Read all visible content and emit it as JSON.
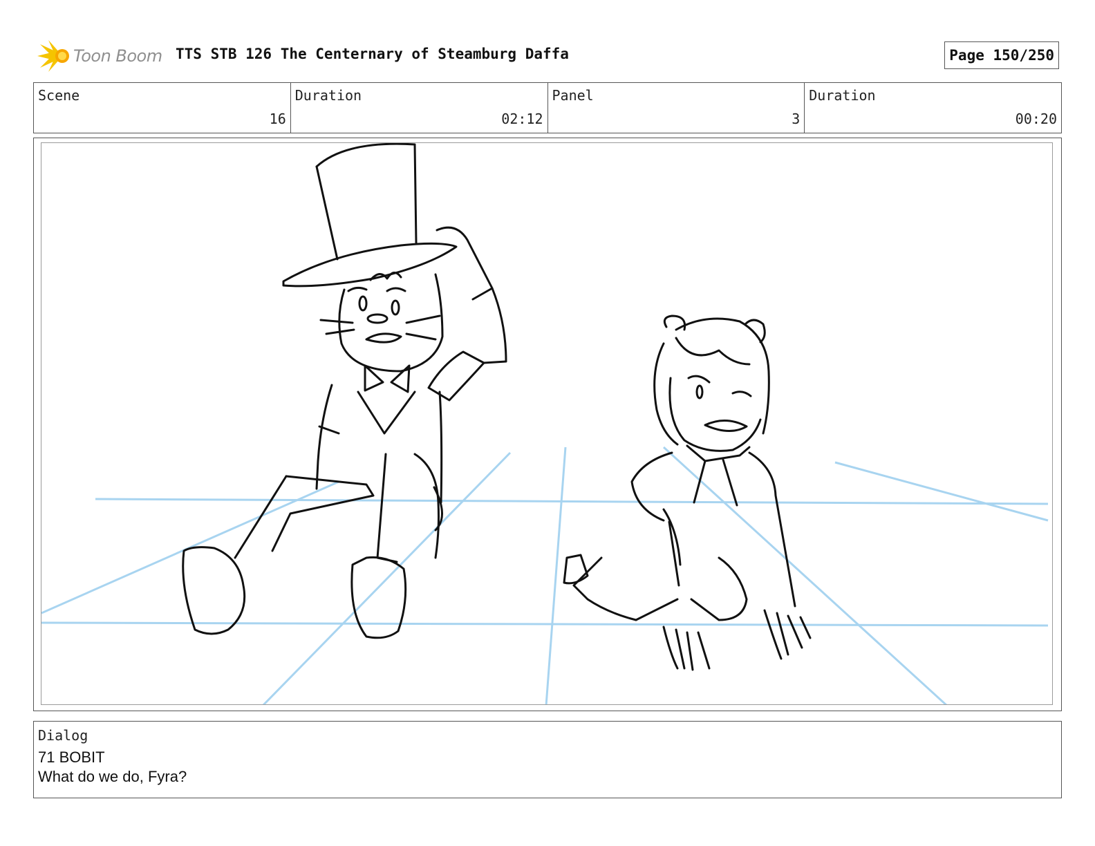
{
  "header": {
    "logo_text": "Toon Boom",
    "title": "TTS STB 126 The Centernary of Steamburg Daffa",
    "page": "Page 150/250"
  },
  "info": {
    "scene_label": "Scene",
    "scene_value": "16",
    "scene_duration_label": "Duration",
    "scene_duration_value": "02:12",
    "panel_label": "Panel",
    "panel_value": "3",
    "panel_duration_label": "Duration",
    "panel_duration_value": "00:20"
  },
  "dialog": {
    "label": "Dialog",
    "speaker": "71 BOBIT",
    "line": "What do we do, Fyra?"
  },
  "colors": {
    "guide_lines": "#a8d4f0",
    "sketch": "#111111",
    "logo_star": "#f5c400"
  }
}
